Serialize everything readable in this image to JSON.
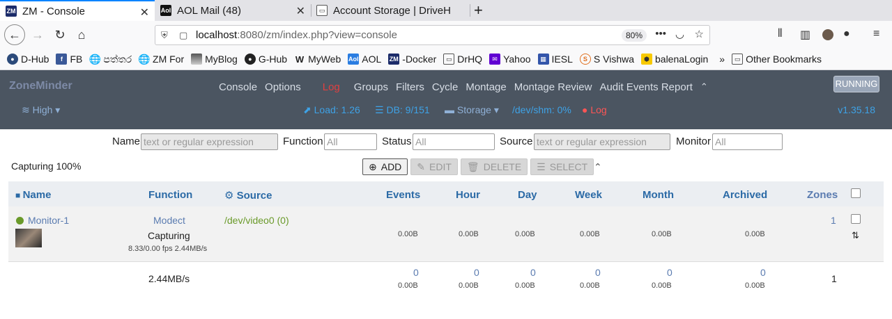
{
  "browser": {
    "tabs": [
      {
        "title": "ZM - Console",
        "icon": "zm-logo-icon",
        "active": true
      },
      {
        "title": "AOL Mail (48)",
        "icon": "aol-icon",
        "active": false
      },
      {
        "title": "Account Storage | DriveH",
        "icon": "page-icon",
        "active": false
      }
    ],
    "url_host": "localhost",
    "url_rest": ":8080/zm/index.php?view=console",
    "zoom": "80%"
  },
  "bookmarks": [
    {
      "label": "D-Hub",
      "icon": "docker-icon"
    },
    {
      "label": "FB",
      "icon": "facebook-icon"
    },
    {
      "label": "පත්තර",
      "icon": "globe-icon"
    },
    {
      "label": "ZM For",
      "icon": "globe-icon"
    },
    {
      "label": "MyBlog",
      "icon": "image-icon"
    },
    {
      "label": "G-Hub",
      "icon": "github-icon"
    },
    {
      "label": "MyWeb",
      "icon": "w-icon"
    },
    {
      "label": "AOL",
      "icon": "aol-icon"
    },
    {
      "label": "-Docker",
      "icon": "zm-logo-icon"
    },
    {
      "label": "DrHQ",
      "icon": "page-icon"
    },
    {
      "label": "Yahoo",
      "icon": "yahoo-icon"
    },
    {
      "label": "IESL",
      "icon": "iesl-icon"
    },
    {
      "label": "S Vishwa",
      "icon": "s-icon"
    },
    {
      "label": "balenaLogin",
      "icon": "balena-icon"
    }
  ],
  "bookmarks_other": "Other Bookmarks",
  "zm": {
    "brand": "ZoneMinder",
    "menu": [
      "Console",
      "Options",
      "Log",
      "Groups",
      "Filters",
      "Cycle",
      "Montage",
      "Montage Review",
      "Audit Events Report"
    ],
    "status": "RUNNING",
    "bandwidth": "High",
    "load": "Load: 1.26",
    "db": "DB: 9/151",
    "storage": "Storage",
    "shm": "/dev/shm: 0%",
    "log": "Log",
    "version": "v1.35.18"
  },
  "filters": {
    "name_label": "Name",
    "name_placeholder": "text or regular expression",
    "function_label": "Function",
    "function_placeholder": "All",
    "status_label": "Status",
    "status_placeholder": "All",
    "source_label": "Source",
    "source_placeholder": "text or regular expression",
    "monitor_label": "Monitor",
    "monitor_placeholder": "All"
  },
  "capturing": "Capturing 100%",
  "actions": {
    "add": "ADD",
    "edit": "EDIT",
    "delete": "DELETE",
    "select": "SELECT"
  },
  "table": {
    "headers": {
      "name": "Name",
      "function": "Function",
      "source": "Source",
      "events": "Events",
      "hour": "Hour",
      "day": "Day",
      "week": "Week",
      "month": "Month",
      "archived": "Archived",
      "zones": "Zones"
    },
    "row": {
      "name": "Monitor-1",
      "function": "Modect",
      "state": "Capturing",
      "fps": "8.33/0.00 fps 2.44MB/s",
      "source": "/dev/video0 (0)",
      "events": "0.00B",
      "hour": "0.00B",
      "day": "0.00B",
      "week": "0.00B",
      "month": "0.00B",
      "archived": "0.00B",
      "zones": "1"
    },
    "totals": {
      "bandwidth": "2.44MB/s",
      "events": "0",
      "events_size": "0.00B",
      "hour": "0",
      "hour_size": "0.00B",
      "day": "0",
      "day_size": "0.00B",
      "week": "0",
      "week_size": "0.00B",
      "month": "0",
      "month_size": "0.00B",
      "archived": "0",
      "archived_size": "0.00B",
      "zones": "1"
    }
  }
}
